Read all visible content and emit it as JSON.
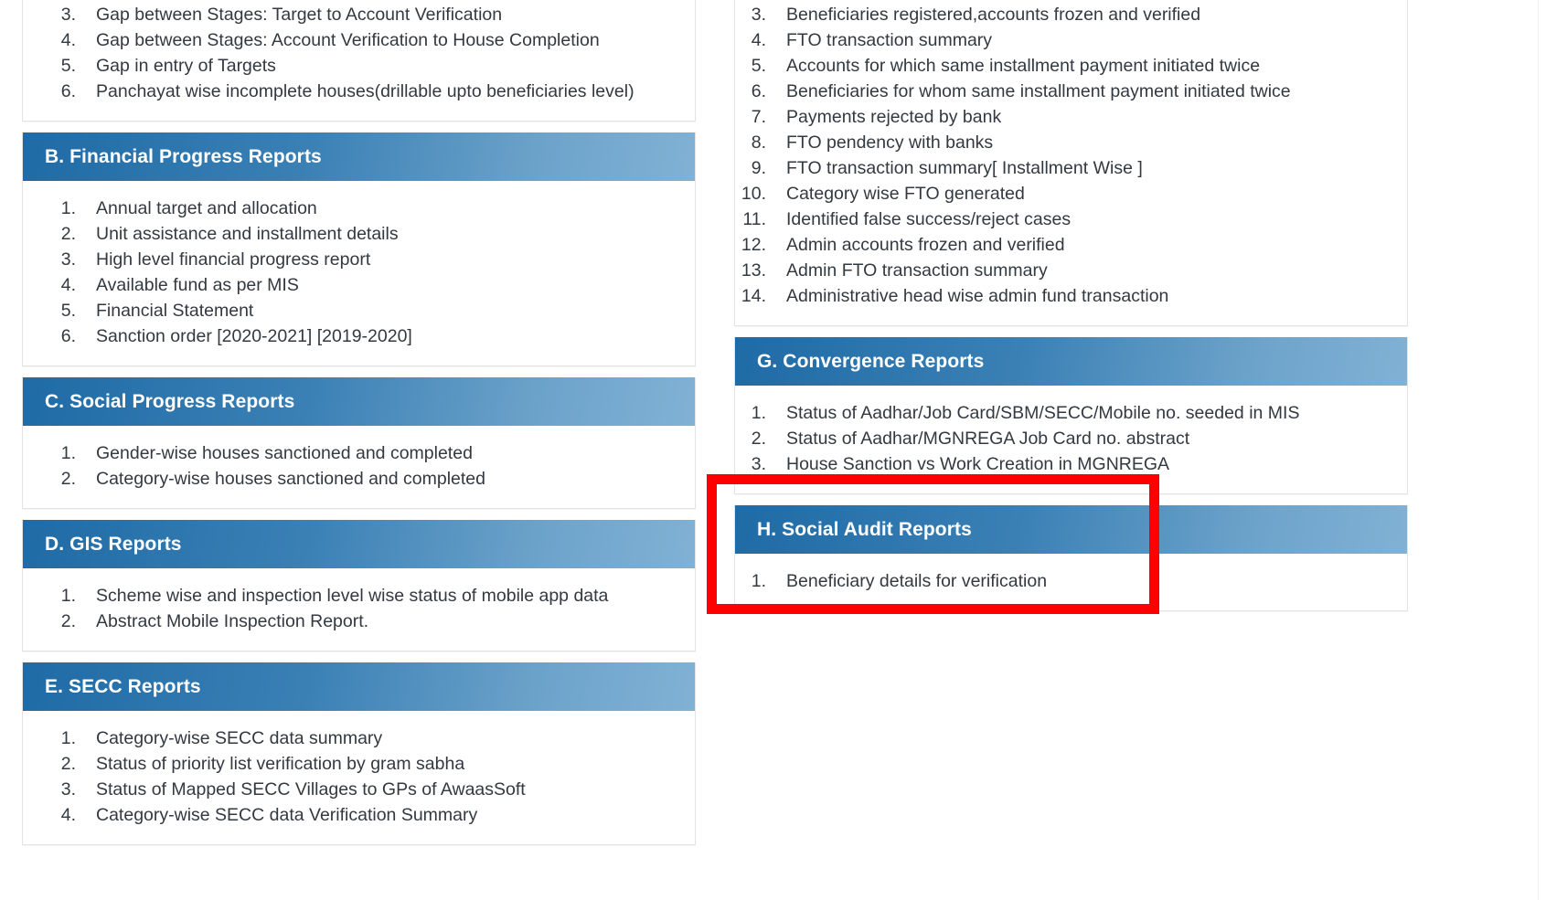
{
  "page": {
    "background": "#ffffff",
    "header_gradient_from": "#1f6ba6",
    "header_gradient_to": "#81b1d5",
    "text_color": "#333940",
    "highlight_color": "#fe0000"
  },
  "left_column": {
    "partial_top_card": {
      "items": [
        {
          "num": "3.",
          "text": "Gap between Stages: Target to Account Verification"
        },
        {
          "num": "4.",
          "text": "Gap between Stages: Account Verification to House Completion"
        },
        {
          "num": "5.",
          "text": "Gap in entry of Targets"
        },
        {
          "num": "6.",
          "text": "Panchayat wise incomplete houses(drillable upto beneficiaries level)"
        }
      ]
    },
    "sections": [
      {
        "id": "financial-progress-reports",
        "title": "B. Financial Progress Reports",
        "items": [
          {
            "num": "1.",
            "text": "Annual target and allocation"
          },
          {
            "num": "2.",
            "text": "Unit assistance and installment details"
          },
          {
            "num": "3.",
            "text": "High level financial progress report"
          },
          {
            "num": "4.",
            "text": "Available fund as per MIS"
          },
          {
            "num": "5.",
            "text": "Financial Statement"
          },
          {
            "num": "6.",
            "text": "Sanction order [2020-2021] [2019-2020]"
          }
        ]
      },
      {
        "id": "social-progress-reports",
        "title": "C. Social Progress Reports",
        "items": [
          {
            "num": "1.",
            "text": "Gender-wise houses sanctioned and completed"
          },
          {
            "num": "2.",
            "text": "Category-wise houses sanctioned and completed"
          }
        ]
      },
      {
        "id": "gis-reports",
        "title": "D. GIS Reports",
        "items": [
          {
            "num": "1.",
            "text": "Scheme wise and inspection level wise status of mobile app data"
          },
          {
            "num": "2.",
            "text": "Abstract Mobile Inspection Report."
          }
        ]
      },
      {
        "id": "secc-reports",
        "title": "E. SECC Reports",
        "items": [
          {
            "num": "1.",
            "text": "Category-wise SECC data summary"
          },
          {
            "num": "2.",
            "text": "Status of priority list verification by gram sabha"
          },
          {
            "num": "3.",
            "text": "Status of Mapped SECC Villages to GPs of AwaasSoft"
          },
          {
            "num": "4.",
            "text": "Category-wise SECC data Verification Summary"
          }
        ]
      }
    ]
  },
  "right_column": {
    "partial_top_card": {
      "items": [
        {
          "num": "3.",
          "text": "Beneficiaries registered,accounts frozen and verified"
        },
        {
          "num": "4.",
          "text": "FTO transaction summary"
        },
        {
          "num": "5.",
          "text": "Accounts for which same installment payment initiated twice"
        },
        {
          "num": "6.",
          "text": "Beneficiaries for whom same installment payment initiated twice"
        },
        {
          "num": "7.",
          "text": "Payments rejected by bank"
        },
        {
          "num": "8.",
          "text": "FTO pendency with banks"
        },
        {
          "num": "9.",
          "text": "FTO transaction summary[ Installment Wise ]"
        },
        {
          "num": "10.",
          "text": "Category wise FTO generated"
        },
        {
          "num": "11.",
          "text": "Identified false success/reject cases"
        },
        {
          "num": "12.",
          "text": "Admin accounts frozen and verified"
        },
        {
          "num": "13.",
          "text": "Admin FTO transaction summary"
        },
        {
          "num": "14.",
          "text": "Administrative head wise admin fund transaction"
        }
      ]
    },
    "sections": [
      {
        "id": "convergence-reports",
        "title": "G. Convergence Reports",
        "items": [
          {
            "num": "1.",
            "text": "Status of Aadhar/Job Card/SBM/SECC/Mobile no. seeded in MIS"
          },
          {
            "num": "2.",
            "text": "Status of Aadhar/MGNREGA Job Card no. abstract"
          },
          {
            "num": "3.",
            "text": "House Sanction vs Work Creation in MGNREGA"
          }
        ]
      },
      {
        "id": "social-audit-reports",
        "title": "H. Social Audit Reports",
        "highlighted": true,
        "items": [
          {
            "num": "1.",
            "text": "Beneficiary details for verification"
          }
        ]
      }
    ]
  },
  "highlight": {
    "target_section": "H. Social Audit Reports",
    "color": "#fe0000",
    "thickness_px": 11
  }
}
